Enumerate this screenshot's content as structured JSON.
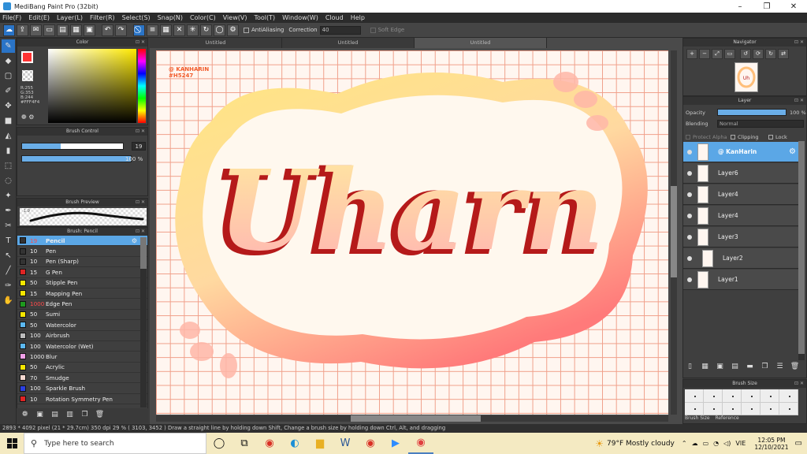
{
  "window": {
    "title": "MediBang Paint Pro (32bit)"
  },
  "menu": [
    "File(F)",
    "Edit(E)",
    "Layer(L)",
    "Filter(R)",
    "Select(S)",
    "Snap(N)",
    "Color(C)",
    "View(V)",
    "Tool(T)",
    "Window(W)",
    "Cloud",
    "Help"
  ],
  "toolbar": {
    "antialias": "AntiAliasing",
    "correction_label": "Correction",
    "correction_value": "40",
    "softedge": "Soft Edge"
  },
  "color_panel": {
    "title": "Color",
    "rgb_text": [
      "R:255",
      "G:353",
      "B:244",
      "#FFF4F4"
    ],
    "fg_color": "#ff3333"
  },
  "brush_control": {
    "title": "Brush Control",
    "size": "19",
    "opacity": "100 %"
  },
  "brush_preview": {
    "title": "Brush Preview",
    "size_label": "1.9"
  },
  "brush_list": {
    "title": "Brush: Pencil",
    "items": [
      {
        "size": "19",
        "name": "Pencil",
        "color": "#333333",
        "selected": true
      },
      {
        "size": "10",
        "name": "Pen",
        "color": "#333333"
      },
      {
        "size": "10",
        "name": "Pen (Sharp)",
        "color": "#333333"
      },
      {
        "size": "15",
        "name": "G Pen",
        "color": "#e02424"
      },
      {
        "size": "50",
        "name": "Stipple Pen",
        "color": "#f5e600"
      },
      {
        "size": "15",
        "name": "Mapping Pen",
        "color": "#f5e600"
      },
      {
        "size": "1000",
        "name": "Edge Pen",
        "color": "#1e9a1e",
        "red": true
      },
      {
        "size": "50",
        "name": "Sumi",
        "color": "#f5e600"
      },
      {
        "size": "50",
        "name": "Watercolor",
        "color": "#5bb8f0"
      },
      {
        "size": "100",
        "name": "Airbrush",
        "color": "#bbbbbb"
      },
      {
        "size": "100",
        "name": "Watercolor (Wet)",
        "color": "#5bb8f0"
      },
      {
        "size": "1000",
        "name": "Blur",
        "color": "#f0a0e8"
      },
      {
        "size": "50",
        "name": "Acrylic",
        "color": "#f5e600"
      },
      {
        "size": "70",
        "name": "Smudge",
        "color": "#f5d8d0"
      },
      {
        "size": "100",
        "name": "Sparkle Brush",
        "color": "#2a40e0"
      },
      {
        "size": "10",
        "name": "Rotation Symmetry Pen",
        "color": "#e02424"
      }
    ]
  },
  "tabs": [
    "Untitled",
    "Untitled",
    "Untitled"
  ],
  "canvas": {
    "watermark_line1": "@ KANHARIN",
    "watermark_line2": "#H5247",
    "lettering": "Uharn"
  },
  "navigator": {
    "title": "Navigator"
  },
  "layer_panel": {
    "title": "Layer",
    "opacity_label": "Opacity",
    "opacity_value": "100 %",
    "opacity_fraction": 0.87,
    "blending_label": "Blending",
    "blending_value": "Normal",
    "protect_alpha": "Protect Alpha",
    "clipping": "Clipping",
    "lock": "Lock",
    "layers": [
      {
        "name": "@ KanHarin",
        "selected": true
      },
      {
        "name": "Layer6"
      },
      {
        "name": "Layer4"
      },
      {
        "name": "Layer4"
      },
      {
        "name": "Layer3"
      },
      {
        "name": "Layer2",
        "indent": true
      },
      {
        "name": "Layer1"
      }
    ]
  },
  "brush_size_panel": {
    "title": "Brush Size",
    "tab1": "Brush Size",
    "tab2": "Reference"
  },
  "status": "2893 * 4092 pixel  (21 * 29.7cm)  350 dpi  29 %  ( 3103, 3452 )  Draw a straight line by holding down Shift, Change a brush size by holding down Ctrl, Alt, and dragging",
  "taskbar": {
    "search_placeholder": "Type here to search",
    "weather": "79°F  Mostly cloudy",
    "lang": "VIE",
    "time": "12:05 PM",
    "date": "12/10/2021"
  }
}
